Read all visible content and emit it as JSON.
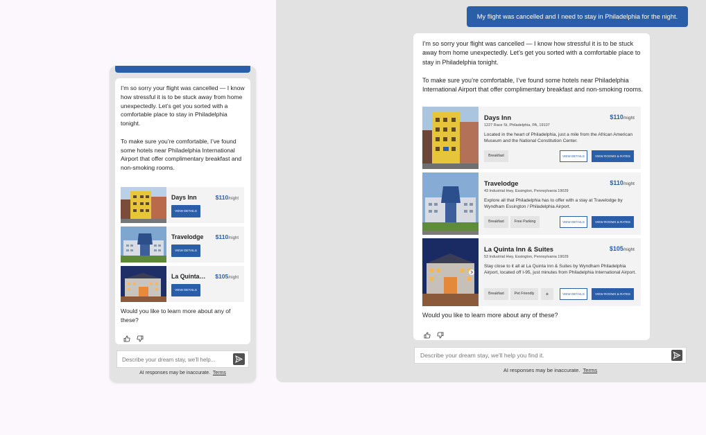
{
  "conversation": {
    "user_message": "My flight was cancelled and I need to stay in Philadelphia for the night.",
    "assistant_intro": "I’m so sorry your flight was cancelled — I know how stressful it is to be stuck away from home unexpectedly. Let’s get you sorted with a comfortable place to stay in Philadelphia tonight.",
    "assistant_hotels_intro": "To make sure you’re comfortable, I’ve found some hotels near Philadelphia International Airport that offer complimentary breakfast and non-smoking rooms.",
    "follow_up": "Would you like to learn more about any of these?"
  },
  "hotels": [
    {
      "name": "Days Inn",
      "mobile_name": "Days Inn",
      "address": "1227 Race St, Philadelphia, PA, 19107",
      "price": "$110",
      "unit": "/night",
      "description": "Located in the heart of Philadelphia, just a mile from the African American Museum and the National Constitution Center.",
      "tags": [
        "Breakfast"
      ],
      "photo_icon": "days-inn-building-photo"
    },
    {
      "name": "Travelodge",
      "mobile_name": "Travelodge",
      "address": "43 Industrial Hwy, Essington, Pennsylvania 19029",
      "price": "$110",
      "unit": "/night",
      "description": "Explore all that Philadelphia has to offer with a stay at Travelodge by Wyndham Essington / Philadelphia Airport.",
      "tags": [
        "Breakfast",
        "Free Parking"
      ],
      "photo_icon": "travelodge-building-photo"
    },
    {
      "name": "La Quinta Inn & Suites",
      "mobile_name": "La Quinta…",
      "address": "53 Industrial Hwy, Essington, Pennsylvania 19029",
      "price": "$105",
      "unit": "/night",
      "description": "Stay close to it all at La Quinta Inn & Suites by Wyndham Philadelphia Airport, located off I-95, just minutes from Philadelphia International Airport.",
      "tags": [
        "Breakfast",
        "Pet Friendly"
      ],
      "more_tags": "+",
      "photo_icon": "la-quinta-building-photo"
    }
  ],
  "buttons": {
    "view_details": "VIEW DETAILS",
    "view_rooms": "VIEW ROOMS & RATES"
  },
  "input": {
    "mobile_placeholder": "Describe your dream stay, we'll help...",
    "desktop_placeholder": "Describe your dream stay, we'll help you find it."
  },
  "footer": {
    "disclaimer": "AI responses may be inaccurate.",
    "terms": "Terms"
  },
  "icons": [
    "thumbs-up-icon",
    "thumbs-down-icon",
    "send-icon"
  ],
  "colors": {
    "accent": "#2a5ea8",
    "panel_bg": "#e2e2e2",
    "page_bg": "#fbf7fd"
  }
}
